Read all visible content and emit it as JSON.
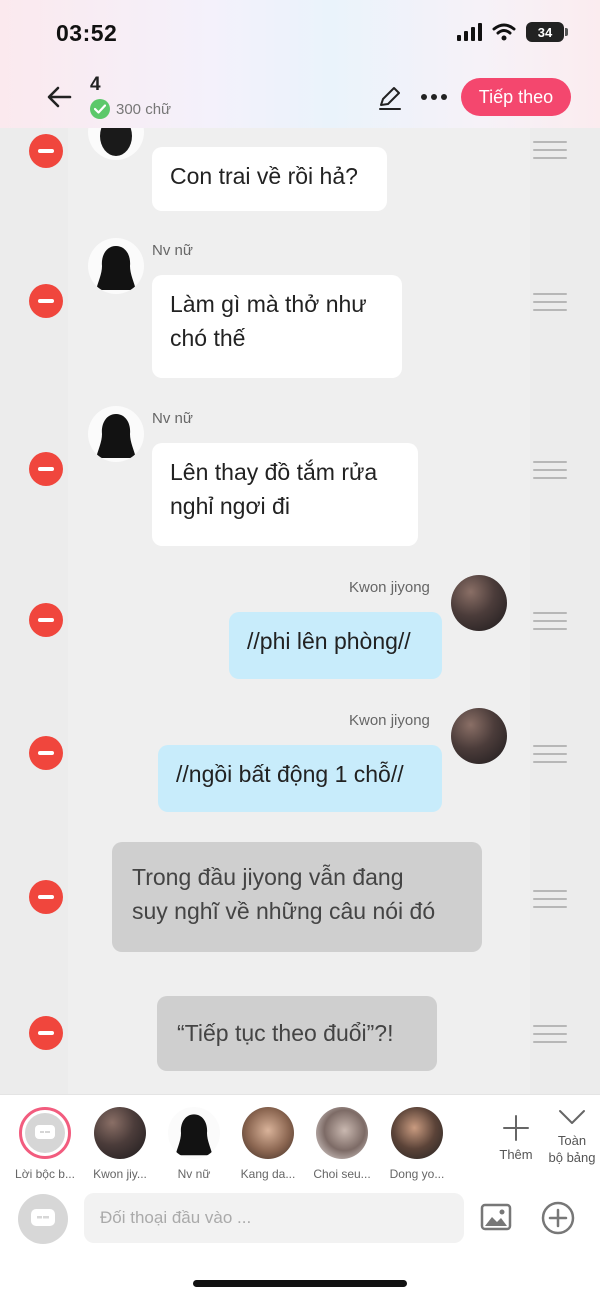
{
  "status": {
    "time": "03:52",
    "battery": "34"
  },
  "header": {
    "episode": "4",
    "word_count": "300 chữ",
    "next_label": "Tiếp theo"
  },
  "messages": [
    {
      "speaker": "",
      "text": "Con trai về rồi hả?"
    },
    {
      "speaker": "Nv nữ",
      "text_lines": [
        "Làm gì mà thở như",
        "chó thế"
      ]
    },
    {
      "speaker": "Nv nữ",
      "text_lines": [
        "Lên thay đồ tắm rửa",
        "nghỉ ngơi đi"
      ]
    },
    {
      "speaker": "Kwon jiyong",
      "text": "//phi lên phòng//"
    },
    {
      "speaker": "Kwon jiyong",
      "text": "//ngồi bất động 1 chỗ//"
    },
    {
      "speaker": "",
      "text_lines": [
        "Trong đầu jiyong vẫn đang",
        "suy nghĩ về những câu nói đó"
      ]
    },
    {
      "speaker": "",
      "text": "“Tiếp tục theo đuổi”?!"
    }
  ],
  "characters": [
    {
      "name": "Lời bộc b..."
    },
    {
      "name": "Kwon jiy..."
    },
    {
      "name": "Nv nữ"
    },
    {
      "name": "Kang da..."
    },
    {
      "name": "Choi seu..."
    },
    {
      "name": "Dong yo..."
    }
  ],
  "toolbar": {
    "add_label": "Thêm",
    "all_label_1": "Toàn",
    "all_label_2": "bộ bảng"
  },
  "input": {
    "placeholder": "Đối thoại đầu vào ..."
  },
  "colors": {
    "accent": "#f4476e",
    "delete": "#f0463d",
    "right_bubble": "#c8ecfb",
    "narration_bubble": "#cfcfcf"
  }
}
